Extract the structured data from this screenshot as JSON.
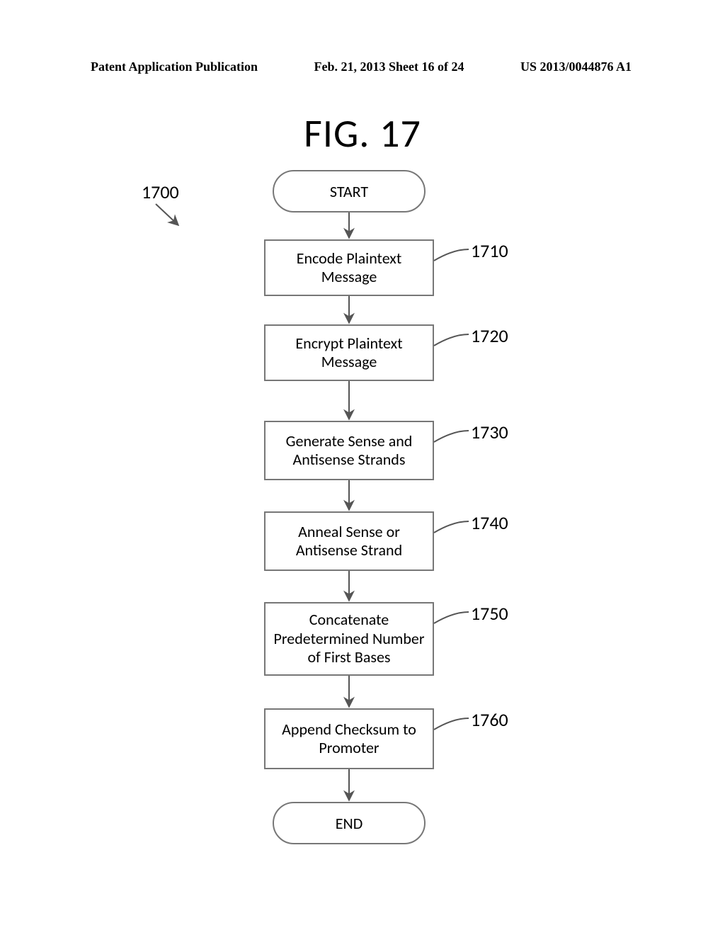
{
  "header": {
    "left": "Patent Application Publication",
    "center": "Feb. 21, 2013  Sheet 16 of 24",
    "right": "US 2013/0044876 A1"
  },
  "figure_title": "FIG. 17",
  "ref_main": "1700",
  "terminator_start": "START",
  "terminator_end": "END",
  "steps": [
    {
      "text": "Encode Plaintext Message",
      "ref": "1710"
    },
    {
      "text": "Encrypt Plaintext Message",
      "ref": "1720"
    },
    {
      "text": "Generate Sense and Antisense Strands",
      "ref": "1730"
    },
    {
      "text": "Anneal Sense or Antisense Strand",
      "ref": "1740"
    },
    {
      "text": "Concatenate Predetermined Number of First Bases",
      "ref": "1750"
    },
    {
      "text": "Append Checksum to Promoter",
      "ref": "1760"
    }
  ]
}
